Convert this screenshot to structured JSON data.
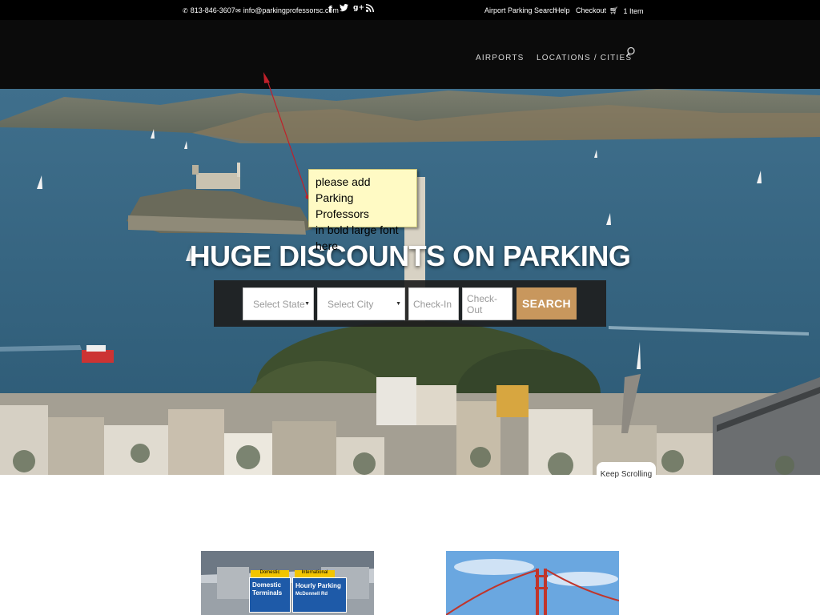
{
  "topbar": {
    "phone": "813-846-3607",
    "email": "info@parkingprofessorsc.com",
    "links": [
      "Airport Parking Search",
      "Help",
      "Checkout"
    ],
    "cart": "1 Item"
  },
  "nav": {
    "items": [
      "AIRPORTS",
      "LOCATIONS / CITIES"
    ]
  },
  "hero": {
    "title": "HUGE DISCOUNTS ON PARKING",
    "state_placeholder": "Select State",
    "city_placeholder": "Select City",
    "checkin_placeholder": "Check-In",
    "checkout_placeholder": "Check-Out",
    "search_label": "SEARCH",
    "keep_scrolling": "Keep Scrolling"
  },
  "annotation": {
    "lines": [
      "please add",
      "Parking Professors",
      "in bold large font here"
    ]
  },
  "cards": {
    "airport_sign_left_tag": "Domestic",
    "airport_sign_left": [
      "Domestic",
      "Terminals"
    ],
    "airport_sign_right_tag": "International",
    "airport_sign_right": [
      "Hourly Parking",
      "McDonnell Rd"
    ]
  },
  "colors": {
    "accent": "#c8975d",
    "header_bg": "#0b0b0b",
    "note_bg": "#fffac4"
  }
}
